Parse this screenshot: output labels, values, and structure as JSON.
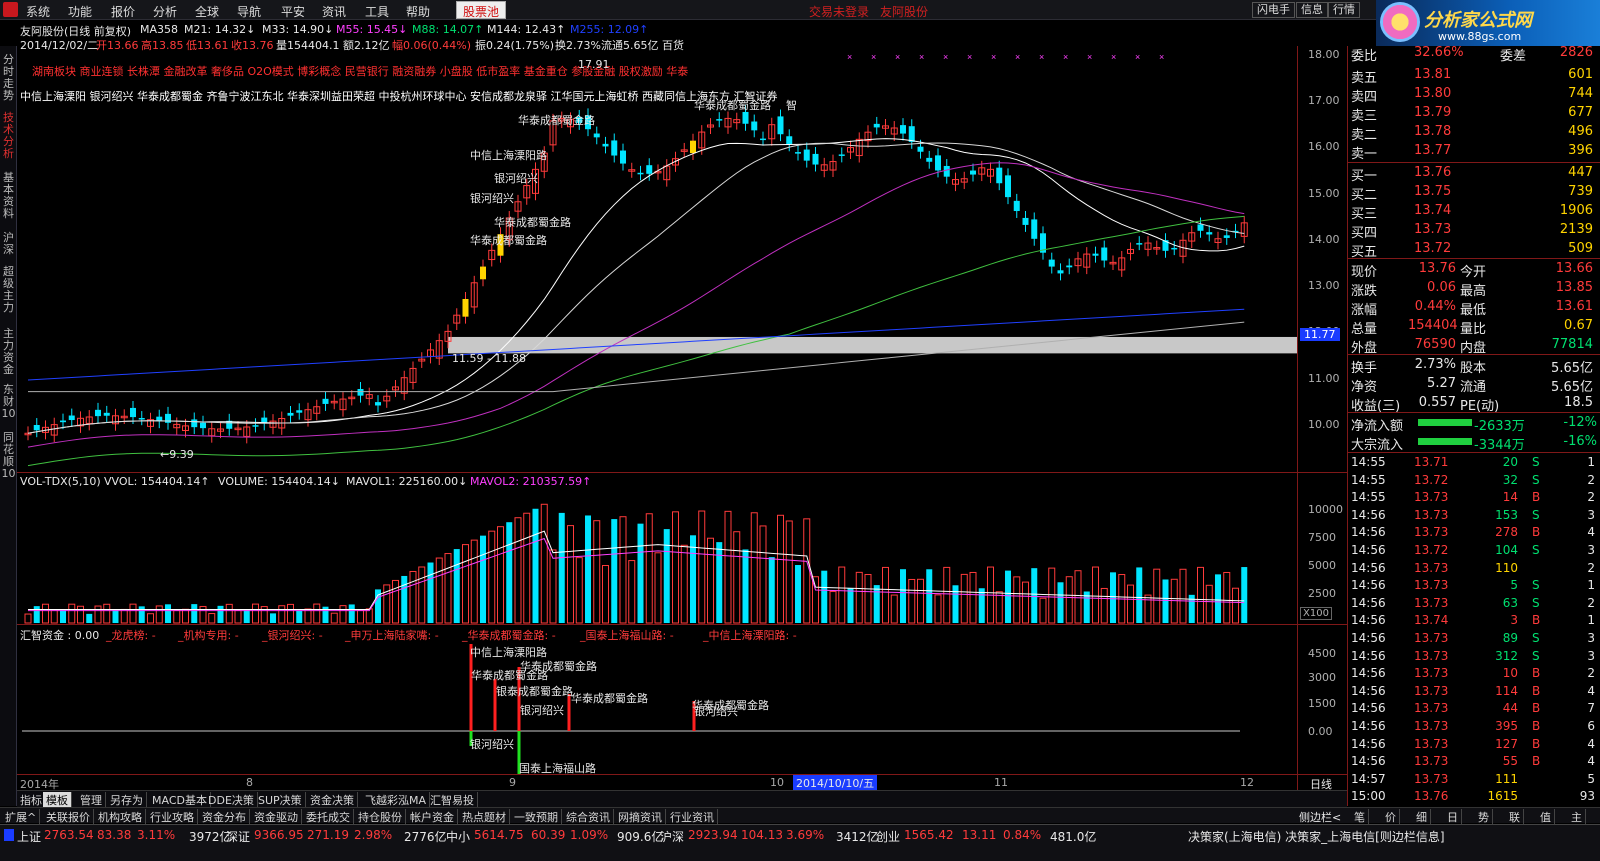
{
  "menu": {
    "items": [
      "系统",
      "功能",
      "报价",
      "分析",
      "全球",
      "导航",
      "平安",
      "资讯",
      "工具",
      "帮助"
    ],
    "pool": "股票池",
    "warn1": "交易未登录",
    "warn2": "友阿股份",
    "rbtns": [
      "闪电手",
      "信息",
      "行情"
    ]
  },
  "brand": {
    "t1": "分析家公式网",
    "t2": "www.88gs.com"
  },
  "lefttabs": [
    "分时走势",
    "技术分析",
    "基本资料",
    "沪深",
    "超级主力",
    "主力资金",
    "东财10",
    "同花顺10"
  ],
  "header": {
    "title": "友阿股份(日线 前复权)",
    "ma358": "MA358",
    "m21": "M21: 14.32↓",
    "m33": "M33: 14.90↓",
    "m55": "M55: 15.45↓",
    "m88": "M88: 14.07↑",
    "m144": "M144: 12.43↑",
    "m255": "M255: 12.09↑",
    "date": "2014/12/02/二",
    "open": "开13.66",
    "high": "高13.85",
    "low": "低13.61",
    "close": "收13.76",
    "vol": "量154404.1",
    "amt": "额2.12亿",
    "chg": "幅0.06(0.44%)",
    "amp": "振0.24(1.75%)",
    "turn": "换2.73%",
    "flt": "流通5.65亿 百货"
  },
  "concepts": "湖南板块 商业连锁 长株潭 金融改革 奢侈品 O2O模式 博彩概念 民营银行 融资融券 小盘股 低市盈率 基金重仓 参股金融 股权激励 华泰",
  "plates": "中信上海溧阳 银河绍兴 华泰成都蜀金 齐鲁宁波江东北 华泰深圳益田荣超 中投杭州环球中心 安信成都龙泉驿 江华国元上海虹桥 西藏同信上海东方 汇智证券",
  "kline": {
    "yticks": [
      "18.00",
      "17.00",
      "16.00",
      "15.00",
      "14.00",
      "13.00",
      "12.00",
      "11.00",
      "10.00"
    ],
    "support_label": "11.59 - 11.88",
    "support_right": "11.77",
    "low_label": "←9.39",
    "high_label": "17.91",
    "labels": [
      "华泰成都蜀金路",
      "中信上海溧阳路",
      "银河绍兴",
      "银河绍兴",
      "华泰成都蜀金路",
      "华泰成都蜀金路",
      "华泰成都蜀金路",
      "智"
    ]
  },
  "vol": {
    "title": "VOL-TDX(5,10)",
    "vvol": "VVOL: 154404.14↑",
    "volume": "VOLUME: 154404.14↓",
    "mavol1": "MAVOL1: 225160.00↓",
    "mavol2": "MAVOL2: 210357.59↑",
    "yticks": [
      "10000",
      "7500",
      "5000",
      "2500"
    ],
    "x100": "X100"
  },
  "hz": {
    "title": "汇智资金 : 0.00",
    "items": [
      "_龙虎榜: -",
      "_机构专用: -",
      "_银河绍兴: -",
      "_申万上海陆家嘴: -",
      "_华泰成都蜀金路: -",
      "_国泰上海福山路: -",
      "_中信上海溧阳路: -"
    ],
    "yticks": [
      "4500",
      "3000",
      "1500",
      "0.00"
    ],
    "labels": [
      "中信上海溧阳路",
      "华泰成都蜀金路",
      "华泰成都蜀金路",
      "银泰成都蜀金路",
      "华泰成都蜀金路",
      "银河绍兴",
      "华泰成都蜀金路",
      "银河绍兴",
      "银河绍兴",
      "国泰上海福山路"
    ]
  },
  "xaxis": {
    "labels": [
      "2014年",
      "8",
      "9",
      "10",
      "2014/10/10/五",
      "11",
      "12"
    ],
    "right": "日线"
  },
  "subtabs": [
    "指标",
    "模板",
    "管理",
    "另存为",
    "MACD基本",
    "DDE决策",
    "SUP决策",
    "资金决策",
    "飞越彩泓MA",
    "汇智易投"
  ],
  "subtabs2": [
    "扩展^",
    "关联报价",
    "机构攻略",
    "行业攻略",
    "资金分布",
    "资金驱动",
    "委托成交",
    "持仓股份",
    "帐户资金",
    "热点题材",
    "一致预期",
    "综合资讯",
    "网摘资讯",
    "行业资讯"
  ],
  "rp": {
    "weibi": [
      "委比",
      "32.66%",
      "委差",
      "2826"
    ],
    "asks": [
      [
        "卖五",
        "13.81",
        "601"
      ],
      [
        "卖四",
        "13.80",
        "744"
      ],
      [
        "卖三",
        "13.79",
        "677"
      ],
      [
        "卖二",
        "13.78",
        "496"
      ],
      [
        "卖一",
        "13.77",
        "396"
      ]
    ],
    "bids": [
      [
        "买一",
        "13.76",
        "447"
      ],
      [
        "买二",
        "13.75",
        "739"
      ],
      [
        "买三",
        "13.74",
        "1906"
      ],
      [
        "买四",
        "13.73",
        "2139"
      ],
      [
        "买五",
        "13.72",
        "509"
      ]
    ],
    "stats": [
      [
        "现价",
        "13.76",
        "今开",
        "13.66"
      ],
      [
        "涨跌",
        "0.06",
        "最高",
        "13.85"
      ],
      [
        "涨幅",
        "0.44%",
        "最低",
        "13.61"
      ],
      [
        "总量",
        "154404",
        "量比",
        "0.67"
      ],
      [
        "外盘",
        "76590",
        "内盘",
        "77814"
      ]
    ],
    "stats2": [
      [
        "换手",
        "2.73%",
        "股本",
        "5.65亿"
      ],
      [
        "净资",
        "5.27",
        "流通",
        "5.65亿"
      ],
      [
        "收益(三)",
        "0.557",
        "PE(动)",
        "18.5"
      ]
    ],
    "flow": [
      [
        "净流入额",
        "-2633万",
        "-12%"
      ],
      [
        "大宗流入",
        "-3344万",
        "-16%"
      ]
    ],
    "ticks": [
      [
        "14:55",
        "13.71",
        "20",
        "S",
        "1"
      ],
      [
        "14:55",
        "13.72",
        "32",
        "S",
        "2"
      ],
      [
        "14:55",
        "13.73",
        "14",
        "B",
        "2"
      ],
      [
        "14:56",
        "13.73",
        "153",
        "S",
        "3"
      ],
      [
        "14:56",
        "13.73",
        "278",
        "B",
        "4"
      ],
      [
        "14:56",
        "13.72",
        "104",
        "S",
        "3"
      ],
      [
        "14:56",
        "13.73",
        "110",
        "",
        "2"
      ],
      [
        "14:56",
        "13.73",
        "5",
        "S",
        "1"
      ],
      [
        "14:56",
        "13.73",
        "63",
        "S",
        "2"
      ],
      [
        "14:56",
        "13.74",
        "3",
        "B",
        "1"
      ],
      [
        "14:56",
        "13.73",
        "89",
        "S",
        "3"
      ],
      [
        "14:56",
        "13.73",
        "312",
        "S",
        "3"
      ],
      [
        "14:56",
        "13.73",
        "10",
        "B",
        "2"
      ],
      [
        "14:56",
        "13.73",
        "114",
        "B",
        "4"
      ],
      [
        "14:56",
        "13.73",
        "44",
        "B",
        "7"
      ],
      [
        "14:56",
        "13.73",
        "395",
        "B",
        "6"
      ],
      [
        "14:56",
        "13.73",
        "127",
        "B",
        "4"
      ],
      [
        "14:56",
        "13.73",
        "55",
        "B",
        "4"
      ],
      [
        "14:57",
        "13.73",
        "111",
        "",
        "5"
      ],
      [
        "15:00",
        "13.76",
        "1615",
        "",
        "93"
      ]
    ],
    "tabs": [
      "笔",
      "价",
      "细",
      "日",
      "势",
      "联",
      "值",
      "主"
    ],
    "side": "侧边栏<"
  },
  "status": {
    "sh": "上证",
    "sh_v": "2763.54",
    "sh_c": "83.38",
    "sh_p": "3.11%",
    "sh_a": "3972亿",
    "sz": "深证",
    "sz_v": "9366.95",
    "sz_c": "271.19",
    "sz_p": "2.98%",
    "sz_a": "2776亿",
    "zx": "中小",
    "zx_v": "5614.75",
    "zx_c": "60.39",
    "zx_p": "1.09%",
    "zx_a": "909.6亿",
    "hs": "沪深",
    "hs_v": "2923.94",
    "hs_c": "104.13",
    "hs_p": "3.69%",
    "hs_a": "3412亿",
    "cy": "创业",
    "cy_v": "1565.42",
    "cy_c": "13.11",
    "cy_p": "0.84%",
    "cy_a": "481.0亿",
    "right": "决策家(上海电信) 决策家_上海电信[则边栏信息]"
  },
  "colors": {
    "up": "#ff3b3b",
    "down": "#00e5ff",
    "bg": "#000000",
    "axis": "#801818"
  }
}
